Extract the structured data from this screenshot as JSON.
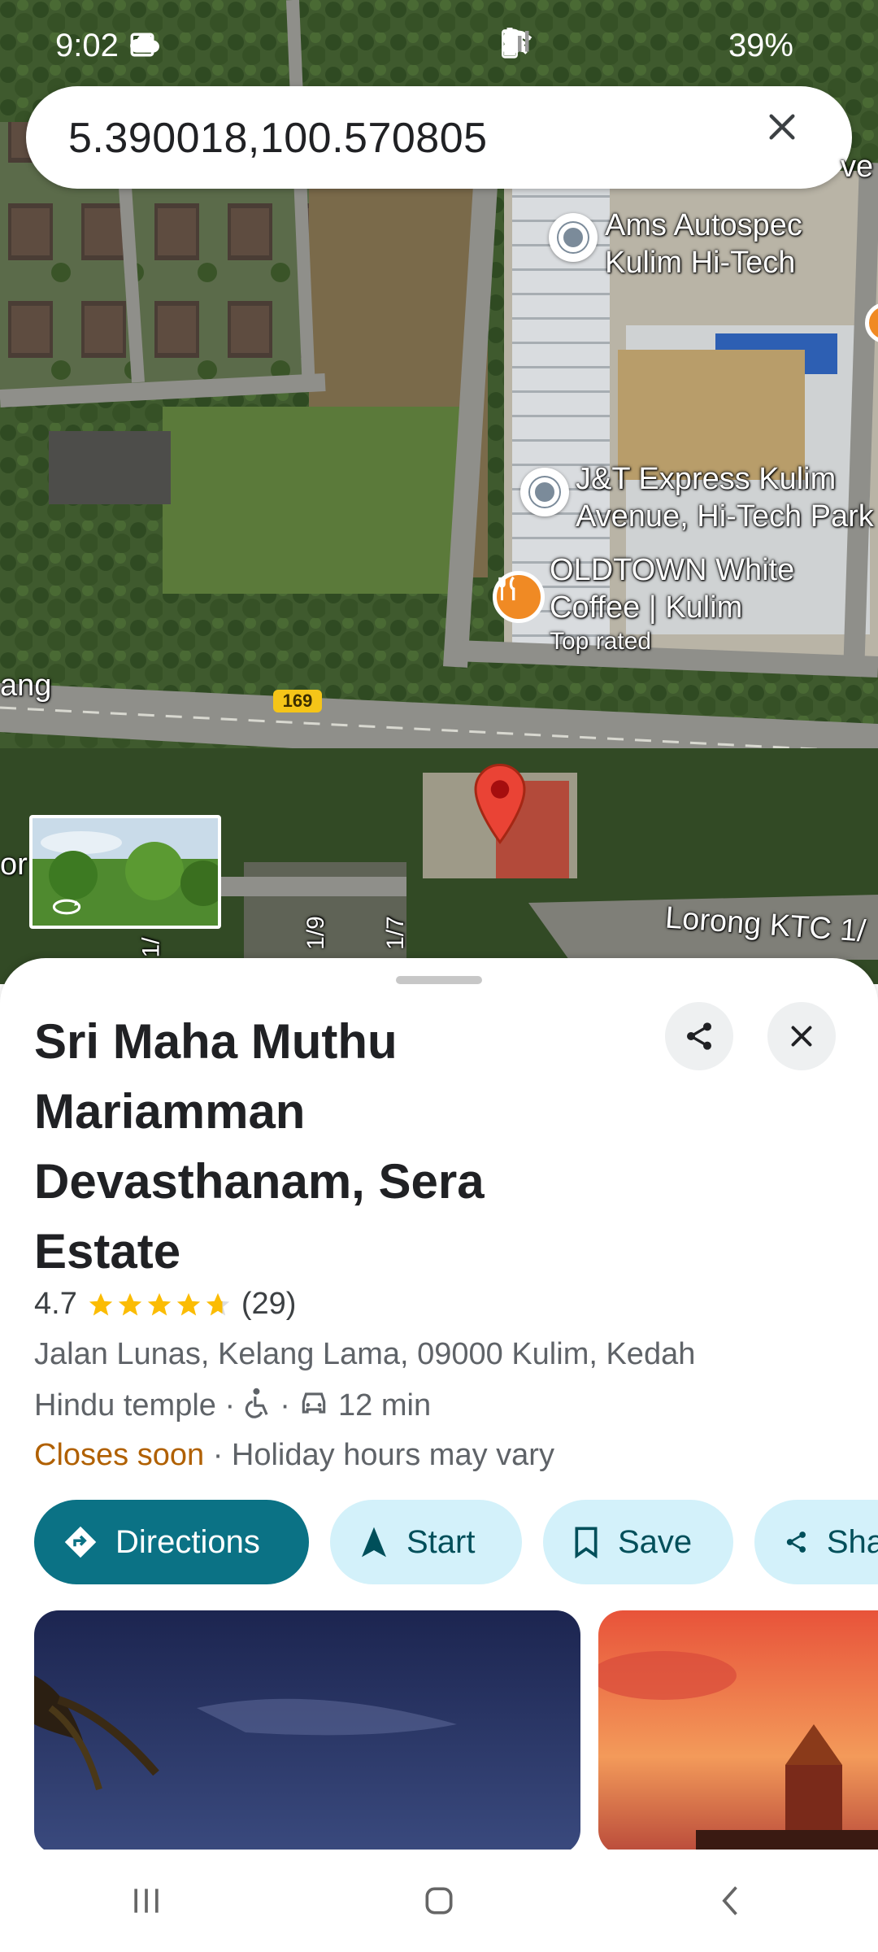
{
  "status_bar": {
    "time": "9:02",
    "battery": "39%",
    "icons": [
      "image-icon",
      "cloud-icon",
      "mute-icon",
      "location-icon",
      "wifi-icon",
      "wifi-call-icon",
      "signal-icon",
      "battery-icon"
    ]
  },
  "search": {
    "query": "5.390018,100.570805"
  },
  "map": {
    "labels": {
      "poi1": "Ams Autospec\nKulim Hi-Tech",
      "poi2": "J&T Express Kulim\nAvenue, Hi-Tech Park",
      "poi3": "OLDTOWN White\nCoffee | Kulim",
      "poi3_badge": "Top rated",
      "road_left": "ang",
      "road_shield": "169",
      "lorong": "Lorong KTC 1/",
      "street_a": "1/9",
      "street_b": "1/7",
      "street_c": "1/",
      "edge_left": "or",
      "edge_top_right": "ve"
    }
  },
  "place": {
    "title": "Sri Maha Muthu Mariamman Devasthanam, Sera Estate",
    "rating": "4.7",
    "stars": 4.7,
    "reviews": "(29)",
    "address": "Jalan Lunas, Kelang Lama, 09000 Kulim, Kedah",
    "category": "Hindu temple",
    "sep": "·",
    "drive_time": "12 min",
    "status": "Closes soon",
    "hours_note": "Holiday hours may vary"
  },
  "actions": {
    "directions": "Directions",
    "start": "Start",
    "save": "Save",
    "share": "Sha"
  },
  "colors": {
    "primary_chip": "#0b7285",
    "secondary_chip": "#d3f1fa",
    "closes_soon": "#b06000",
    "star": "#fbbc04",
    "pin": "#ea4335"
  }
}
